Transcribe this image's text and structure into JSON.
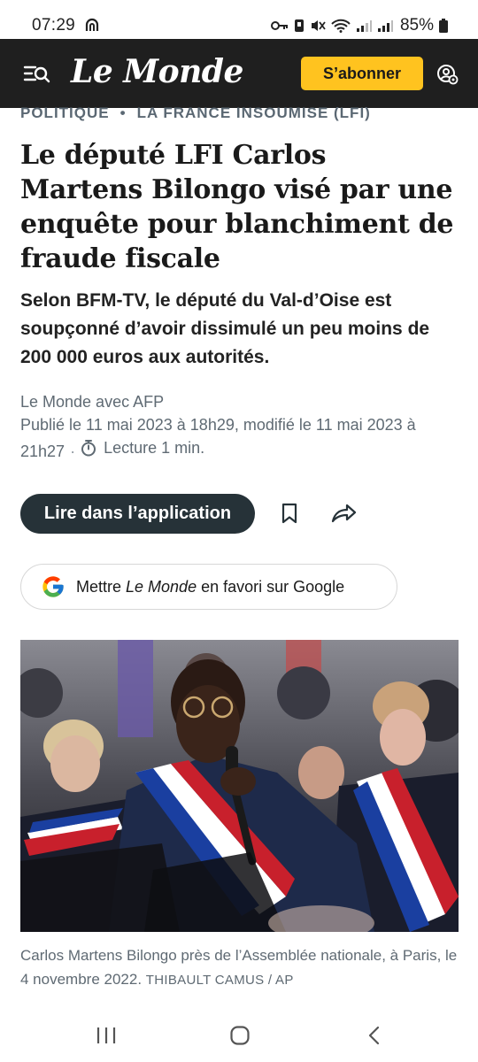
{
  "status_bar": {
    "time": "07:29",
    "battery": "85%"
  },
  "header": {
    "logo": "Le Monde",
    "subscribe_label": "S’abonner",
    "brand_color": "#1f1f1f",
    "accent_color": "#ffc31f"
  },
  "article": {
    "breadcrumb": [
      "POLITIQUE",
      "LA FRANCE INSOUMISE (LFI)"
    ],
    "breadcrumb_separator": "•",
    "headline": "Le député LFI Carlos Martens Bilongo visé par une enquête pour blanchiment de fraude fiscale",
    "standfirst": "Selon BFM-TV, le député du Val-d’Oise est soupçonné d’avoir dissimulé un peu moins de 200 000 euros aux autorités.",
    "author": "Le Monde avec AFP",
    "published": "Publié le 11 mai 2023 à 18h29, modifié le 11 mai 2023 à 21h27",
    "reading_time": "Lecture 1 min."
  },
  "actions": {
    "read_in_app": "Lire dans l’application",
    "google_prefix": "Mettre ",
    "google_brand": "Le Monde",
    "google_suffix": " en favori sur Google"
  },
  "photo": {
    "caption": "Carlos Martens Bilongo près de l’Assemblée nationale, à Paris, le 4 novembre 2022.",
    "credit": "THIBAULT CAMUS / AP"
  },
  "icons": {
    "menu": "menu-search-icon",
    "account": "account-settings-icon",
    "bookmark": "bookmark-icon",
    "share": "share-icon",
    "timer": "stopwatch-icon",
    "google": "google-logo-icon"
  }
}
